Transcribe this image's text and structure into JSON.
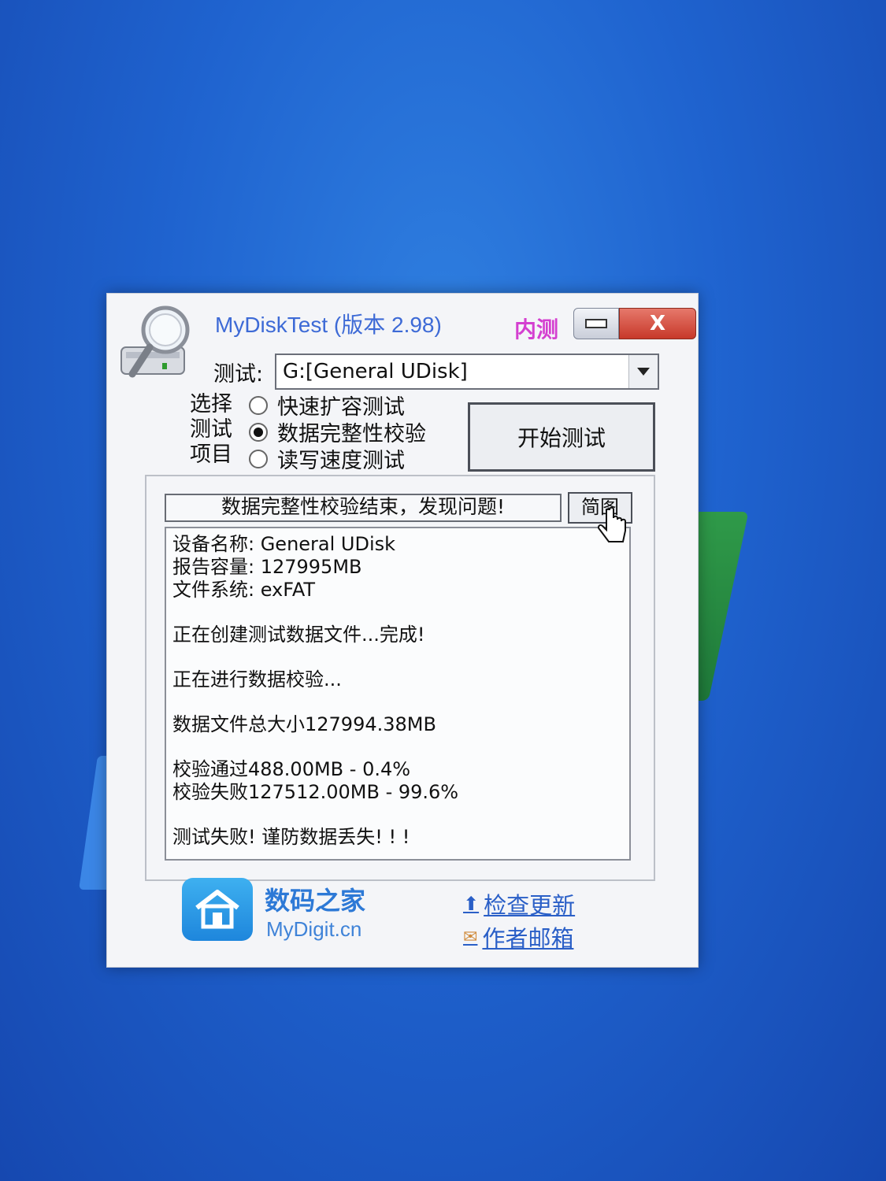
{
  "window": {
    "title": "MyDiskTest (版本 2.98)",
    "beta_badge": "内测",
    "close_label": "X"
  },
  "test": {
    "label": "测试:",
    "drive_value": "G:[General UDisk]"
  },
  "select": {
    "label_lines": [
      "选择",
      "测试",
      "项目"
    ],
    "options": [
      {
        "label": "快速扩容测试",
        "selected": false
      },
      {
        "label": "数据完整性校验",
        "selected": true
      },
      {
        "label": "读写速度测试",
        "selected": false
      }
    ]
  },
  "start_button": "开始测试",
  "status": {
    "message": "数据完整性校验结束，发现问题!",
    "simple_button": "简图"
  },
  "report": {
    "device_name": "设备名称: General UDisk",
    "reported_capacity": "报告容量: 127995MB",
    "file_system": "文件系统: exFAT",
    "creating": "正在创建测试数据文件...完成!",
    "verifying": "正在进行数据校验...",
    "total_size": "数据文件总大小127994.38MB",
    "passed": "校验通过488.00MB - 0.4%",
    "failed": "校验失败127512.00MB - 99.6%",
    "result": "测试失败! 谨防数据丢失! ! !"
  },
  "footer": {
    "brand_name": "数码之家",
    "brand_url": "MyDigit.cn",
    "check_update": "检查更新",
    "author_email": "作者邮箱"
  },
  "colors": {
    "desktop": "#1f63cf",
    "title": "#3d6ad6",
    "beta": "#d43fd0",
    "close": "#c7392a",
    "link": "#2a5fc7"
  }
}
